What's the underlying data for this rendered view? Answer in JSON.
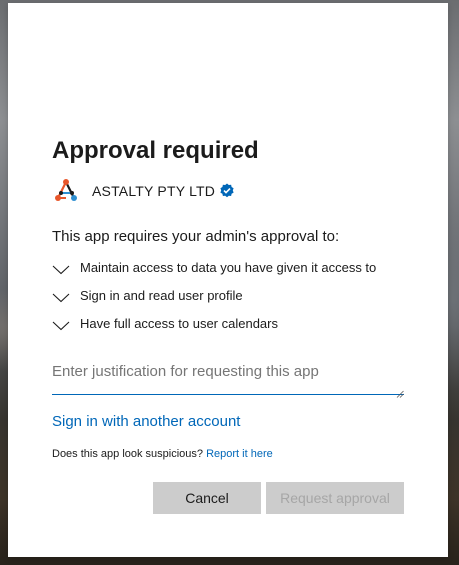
{
  "dialog": {
    "title": "Approval required",
    "publisher": {
      "name": "ASTALTY PTY LTD",
      "logo_icon": "astalty-logo-icon",
      "verified_icon": "verified-badge-icon",
      "logo_colors": [
        "#1b1b1b",
        "#e8562a",
        "#2f8fd1"
      ]
    },
    "intro": "This app requires your admin's approval to:",
    "permissions": [
      {
        "label": "Maintain access to data you have given it access to",
        "icon": "chevron-down-icon"
      },
      {
        "label": "Sign in and read user profile",
        "icon": "chevron-down-icon"
      },
      {
        "label": "Have full access to user calendars",
        "icon": "chevron-down-icon"
      }
    ],
    "justification": {
      "value": "",
      "placeholder": "Enter justification for requesting this app"
    },
    "switch_account_link": "Sign in with another account",
    "suspicious": {
      "question": "Does this app look suspicious?",
      "report_link": "Report it here"
    },
    "buttons": {
      "cancel": "Cancel",
      "request": "Request approval",
      "request_enabled": false
    }
  },
  "colors": {
    "link": "#0067b8",
    "button_bg": "#cccccc",
    "disabled_text": "#a6a6a6"
  }
}
